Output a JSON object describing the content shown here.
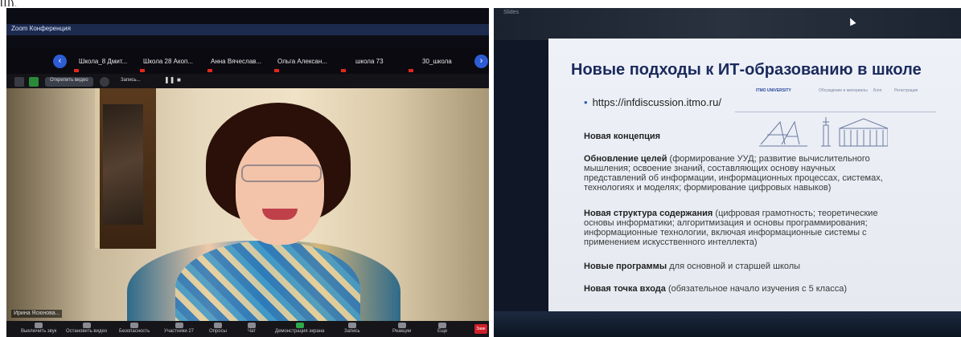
{
  "corner_glyph": "Ш).",
  "zoom": {
    "window_title": "Zoom Конференция",
    "participants": [
      "Школа_8 Дмит...",
      "Школа 28 Акоп...",
      "Анна Вячеслав...",
      "Ольга Алексан...",
      "школа 73",
      "30_школа"
    ],
    "stop_video_label": "Открепить видео",
    "recording_label": "Запись...",
    "speaker_name": "Ирина Ясюнова...",
    "controls": [
      {
        "label": "Выключить звук"
      },
      {
        "label": "Остановить видео"
      },
      {
        "label": "Безопасность"
      },
      {
        "label": "Участники",
        "count": "27"
      },
      {
        "label": "Опросы"
      },
      {
        "label": "Чат"
      },
      {
        "label": "Демонстрация экрана"
      },
      {
        "label": "Запись"
      },
      {
        "label": "Реакции"
      },
      {
        "label": "Еще"
      }
    ],
    "end_label": "Заве"
  },
  "slide": {
    "top_text": "Slides",
    "title": "Новые подходы к ИТ-образованию в школе",
    "itmo_logo": "ITMO UNIVERSITY",
    "itmo_links": [
      "Обсуждение и материалы",
      "Блог",
      "Регистрация"
    ],
    "url": "https://infdiscussion.itmo.ru/",
    "concept_heading": "Новая концепция",
    "p1_bold": "Обновление целей",
    "p1_line1": " (формирование УУД; развитие вычислительного",
    "p1_line2": "мышления; освоение знаний, составляющих основу научных",
    "p1_line3": "представлений об информации, информационных процессах, системах,",
    "p1_line4": "технологиях и моделях; формирование цифровых навыков)",
    "p2_bold": "Новая структура содержания",
    "p2_line1": " (цифровая грамотность; теоретические",
    "p2_line2": "основы информатики; алгоритмизация и основы программирования;",
    "p2_line3": "информационные технологии, включая информационные системы с",
    "p2_line4": "применением искусственного интеллекта)",
    "p3_bold": "Новые программы",
    "p3_rest": " для основной и старшей школы",
    "p4_bold": "Новая точка входа",
    "p4_rest": " (обязательное начало изучения с 5 класса)"
  },
  "colors": {
    "slide_title": "#1a2a5c",
    "zoom_accent": "#2d5cd4",
    "end_button": "#d0202a"
  }
}
